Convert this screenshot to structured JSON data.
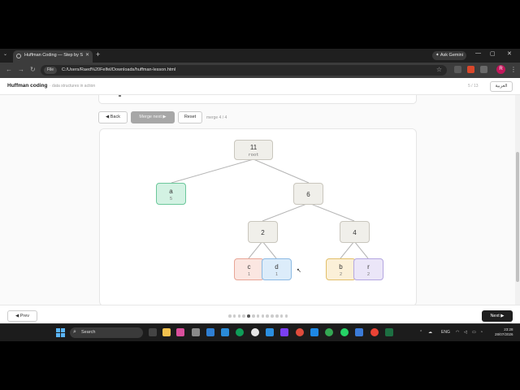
{
  "browser": {
    "tab_title": "Huffman Coding — Step by St",
    "url": "C:/Users/Raed%20Felfel/Downloads/huffman-lesson.html",
    "file_chip": "File",
    "ask_gemini": "Ask Gemini",
    "profile_initial": "R"
  },
  "header": {
    "title": "Huffman coding",
    "subtitle": "· data structures in action",
    "step": "5 / 13",
    "lang_button": "العربية"
  },
  "controls": {
    "back": "◀ Back",
    "merge_next": "Merge next ▶",
    "reset": "Reset",
    "merge_progress": "merge 4 / 4"
  },
  "tree": {
    "root": {
      "value": "11",
      "label": "root"
    },
    "n6": {
      "value": "6"
    },
    "n2": {
      "value": "2"
    },
    "n4": {
      "value": "4"
    },
    "leaves": [
      {
        "char": "a",
        "freq": "5",
        "color": "#d3f2e3",
        "border": "#6cc79b"
      },
      {
        "char": "c",
        "freq": "1",
        "color": "#fbe6e1",
        "border": "#e8a596"
      },
      {
        "char": "d",
        "freq": "1",
        "color": "#dcecfa",
        "border": "#8bb9e3"
      },
      {
        "char": "b",
        "freq": "2",
        "color": "#fbf0d8",
        "border": "#e2bf6a"
      },
      {
        "char": "r",
        "freq": "2",
        "color": "#ebe6f8",
        "border": "#b4a6e0"
      }
    ],
    "internal_color": "#f0efea",
    "internal_border": "#c9c6bd"
  },
  "footer": {
    "prev": "◀ Prev",
    "next": "Next ▶",
    "total_steps": 13,
    "current_step": 5
  },
  "taskbar": {
    "search": "Search",
    "lang": "ENG",
    "time": "23:28",
    "date": "28/07/2026"
  }
}
